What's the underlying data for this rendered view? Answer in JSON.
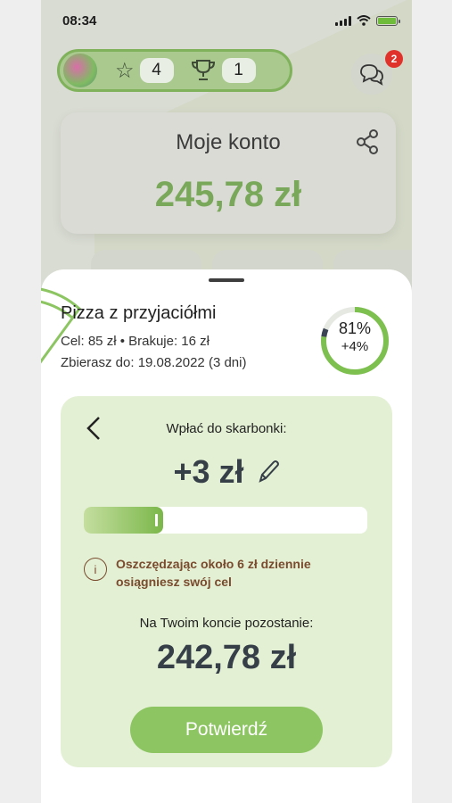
{
  "status_bar": {
    "time": "08:34"
  },
  "header": {
    "stars": "4",
    "trophies": "1",
    "chat_badge": "2"
  },
  "account": {
    "title": "Moje konto",
    "balance": "245,78 zł"
  },
  "goal": {
    "name": "Pizza z przyjaciółmi",
    "target_line": "Cel: 85 zł • Brakuje: 16 zł",
    "deadline_line": "Zbierasz do: 19.08.2022 (3 dni)",
    "progress_percent": "81%",
    "progress_delta": "+4%",
    "progress_value": 81,
    "delta_value": 4
  },
  "deposit": {
    "label": "Wpłać do skarbonki:",
    "amount": "+3 zł",
    "slider_fraction": 0.28,
    "tip": "Oszczędzając około 6 zł dziennie osiągniesz swój cel",
    "remaining_label": "Na Twoim koncie pozostanie:",
    "remaining_amount": "242,78 zł",
    "confirm_label": "Potwierdź"
  },
  "colors": {
    "accent": "#8cc562",
    "tip": "#7a4b2e",
    "ring": "#7ec04f"
  }
}
